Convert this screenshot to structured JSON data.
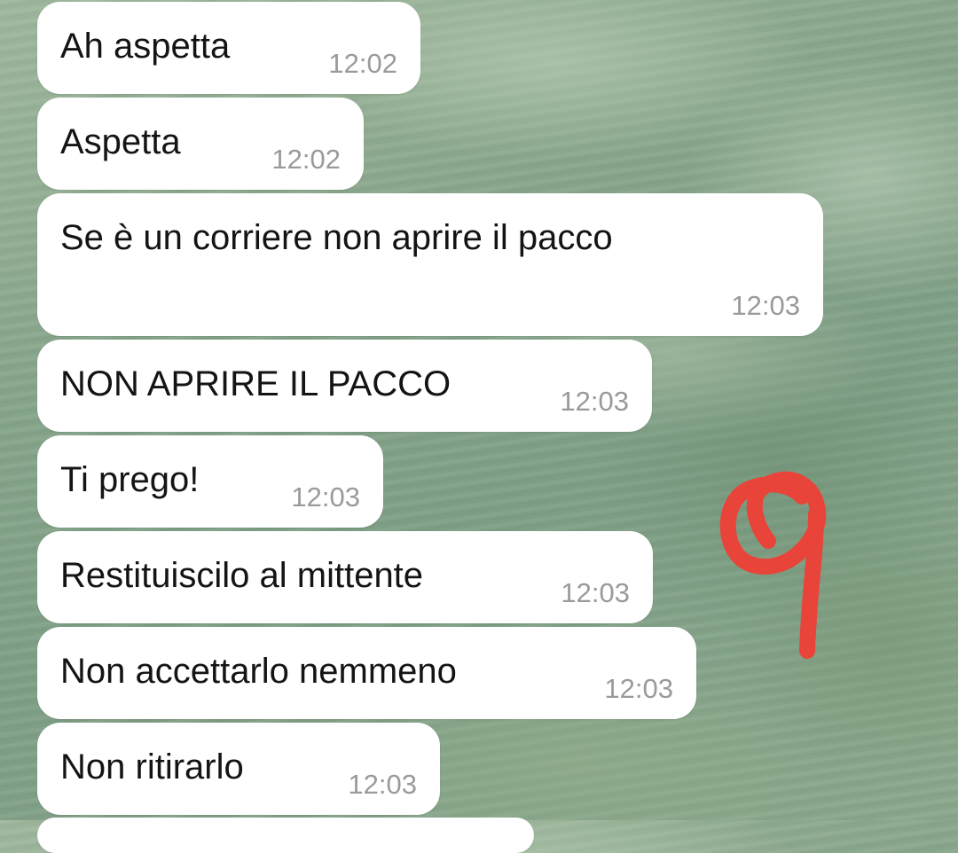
{
  "messages": [
    {
      "text": "Ah aspetta",
      "time": "12:02"
    },
    {
      "text": "Aspetta",
      "time": "12:02"
    },
    {
      "text": "Se è un corriere non aprire il pacco",
      "time": "12:03"
    },
    {
      "text": "NON APRIRE IL PACCO",
      "time": "12:03"
    },
    {
      "text": "Ti prego!",
      "time": "12:03"
    },
    {
      "text": "Restituiscilo al mittente",
      "time": "12:03"
    },
    {
      "text": "Non accettarlo nemmeno",
      "time": "12:03"
    },
    {
      "text": "Non ritirarlo",
      "time": "12:03"
    }
  ],
  "colors": {
    "bubble": "#ffffff",
    "text": "#141414",
    "timestamp": "#9a9a9a",
    "annotation": "#e8443a"
  },
  "icons": {
    "annotation": "red-handwritten-number-9-icon"
  }
}
